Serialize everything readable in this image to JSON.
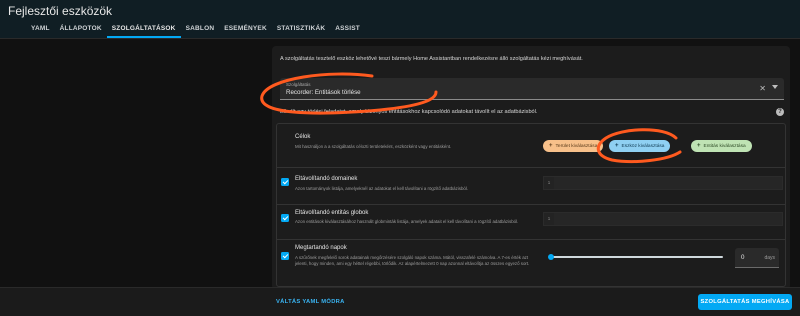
{
  "app": {
    "title": "Fejlesztői eszközök"
  },
  "tabs": [
    {
      "label": "YAML"
    },
    {
      "label": "ÁLLAPOTOK"
    },
    {
      "label": "SZOLGÁLTATÁSOK"
    },
    {
      "label": "SABLON"
    },
    {
      "label": "ESEMÉNYEK"
    },
    {
      "label": "STATISZTIKÁK"
    },
    {
      "label": "ASSIST"
    }
  ],
  "active_tab": "SZOLGÁLTATÁSOK",
  "intro": "A szolgáltatás tesztelő eszköz lehetővé teszi bármely Home Assistantban rendelkezésre álló szolgáltatás kézi meghívását.",
  "service_select": {
    "label": "Szolgáltatás",
    "value": "Recorder: Entitások törlése",
    "clear_icon": "close-icon",
    "arrow_icon": "chevron-down-icon"
  },
  "service_description": "Elindít egy törlési feladatot, amely bizonyos entitásokhoz kapcsolódó adatokat távolít el az adatbázisból.",
  "targets": {
    "title": "Célok",
    "description": "Mit használjon a a szolgáltatás célozti területeként, eszközként vagy entitásként.",
    "chips": [
      {
        "label": "Terület kiválasztása",
        "icon": "plus-icon"
      },
      {
        "label": "Eszköz kiválasztása",
        "icon": "plus-icon"
      },
      {
        "label": "Entitás kiválasztása",
        "icon": "plus-icon"
      }
    ]
  },
  "fields": [
    {
      "title": "Eltávolítandó domainek",
      "description": "Azon tartományok listája, amelyeknél az adatokat el kell távolítani a rögzítő adatbázisból.",
      "checked": true,
      "gutter": "1"
    },
    {
      "title": "Eltávolítandó entitás globok",
      "description": "Azon entitások kiválasztásához használt globminták listája, amelyek adatait el kell távolítani a rögzítő adatbázisból.",
      "checked": true,
      "gutter": "1"
    },
    {
      "title": "Megtartandó napok",
      "description": "A szűrőnek megfelelő sorok adatainak megőrzésére szolgáló napok száma. Mától, visszafelé számolva. A 7-es érték azt jelenti, hogy minden, ami egy héttel régebbi, törlődik. Az alapértelmezett 0 nap azonnal eltávolítja az összes egyező sort.",
      "checked": true,
      "value": "0",
      "unit": "days",
      "slider_fraction": 0
    }
  ],
  "footer": {
    "yaml_mode": "VÁLTÁS YAML MÓDRA",
    "call_service": "SZOLGÁLTATÁS MEGHÍVÁSA"
  },
  "colors": {
    "accent": "#03a9f4",
    "header_bg": "#101e24",
    "annotation": "#ff5a1f"
  }
}
